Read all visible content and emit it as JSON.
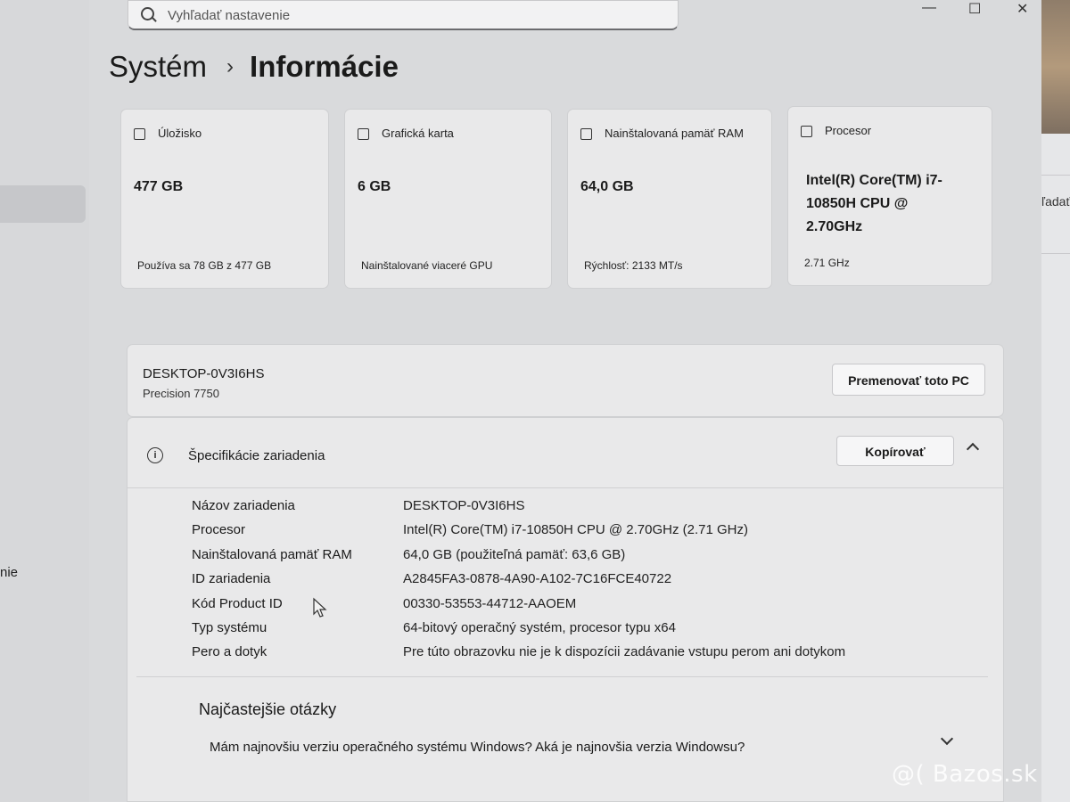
{
  "search": {
    "placeholder": "Vyhľadať nastavenie"
  },
  "sidebar": {
    "fragment": "nie"
  },
  "right_window": {
    "fragment": "ľadať"
  },
  "breadcrumb": {
    "parent": "Systém",
    "separator": "›",
    "current": "Informácie"
  },
  "cards": [
    {
      "icon": "storage-icon",
      "label": "Úložisko",
      "value": "477 GB",
      "sub": "Používa sa 78 GB z 477 GB"
    },
    {
      "icon": "gpu-icon",
      "label": "Grafická karta",
      "value": "6 GB",
      "sub": "Nainštalované viaceré GPU"
    },
    {
      "icon": "ram-icon",
      "label": "Nainštalovaná pamäť RAM",
      "value": "64,0 GB",
      "sub": "Rýchlosť: 2133 MT/s"
    },
    {
      "icon": "cpu-icon",
      "label": "Procesor",
      "value": "Intel(R) Core(TM) i7-10850H CPU @ 2.70GHz",
      "sub": "2.71 GHz"
    }
  ],
  "pc": {
    "name": "DESKTOP-0V3I6HS",
    "model": "Precision 7750",
    "rename_label": "Premenovať toto PC"
  },
  "specs": {
    "title": "Špecifikácie zariadenia",
    "copy_label": "Kopírovať",
    "rows": [
      {
        "key": "Názov zariadenia",
        "value": "DESKTOP-0V3I6HS"
      },
      {
        "key": "Procesor",
        "value": "Intel(R) Core(TM) i7-10850H CPU @ 2.70GHz (2.71 GHz)"
      },
      {
        "key": "Nainštalovaná pamäť RAM",
        "value": "64,0 GB (použiteľná pamäť: 63,6 GB)"
      },
      {
        "key": "ID zariadenia",
        "value": "A2845FA3-0878-4A90-A102-7C16FCE40722"
      },
      {
        "key": "Kód Product ID",
        "value": "00330-53553-44712-AAOEM"
      },
      {
        "key": "Typ systému",
        "value": "64-bitový operačný systém, procesor typu x64"
      },
      {
        "key": "Pero a dotyk",
        "value": "Pre túto obrazovku nie je k dispozícii zadávanie vstupu perom ani dotykom"
      }
    ]
  },
  "faq": {
    "title": "Najčastejšie otázky",
    "question": "Mám najnovšiu verziu operačného systému Windows? Aká je najnovšia verzia Windowsu?"
  },
  "watermark": "@( Bazos.sk"
}
